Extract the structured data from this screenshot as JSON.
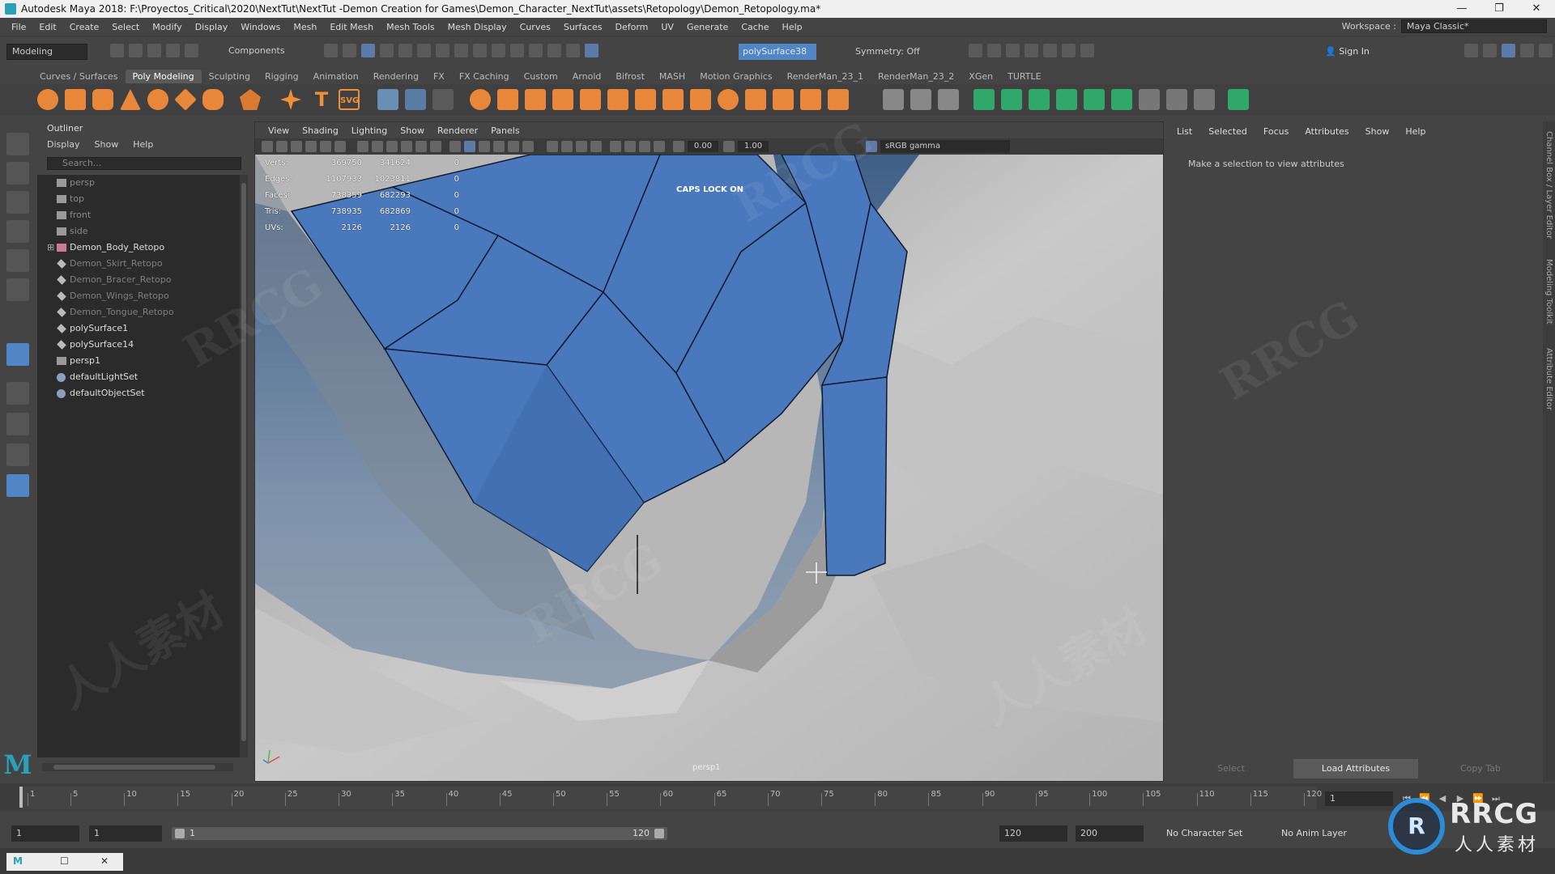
{
  "window": {
    "title": "Autodesk Maya 2018: F:\\Proyectos_Critical\\2020\\NextTut\\NextTut -Demon Creation for Games\\Demon_Character_NextTut\\assets\\Retopology\\Demon_Retopology.ma*",
    "controls": [
      "—",
      "❐",
      "✕"
    ]
  },
  "menubar": {
    "items": [
      "File",
      "Edit",
      "Create",
      "Select",
      "Modify",
      "Display",
      "Windows",
      "Mesh",
      "Edit Mesh",
      "Mesh Tools",
      "Mesh Display",
      "Curves",
      "Surfaces",
      "Deform",
      "UV",
      "Generate",
      "Cache",
      "Help"
    ],
    "workspace_label": "Workspace :",
    "workspace_value": "Maya Classic*"
  },
  "statusline": {
    "mode": "Modeling",
    "selection_mask": "Components",
    "object_field": "polySurface38",
    "symmetry": "Symmetry: Off",
    "sign_in": "Sign In"
  },
  "shelf": {
    "tabs": [
      "Curves / Surfaces",
      "Poly Modeling",
      "Sculpting",
      "Rigging",
      "Animation",
      "Rendering",
      "FX",
      "FX Caching",
      "Custom",
      "Arnold",
      "Bifrost",
      "MASH",
      "Motion Graphics",
      "RenderMan_23_1",
      "RenderMan_23_2",
      "XGen",
      "TURTLE"
    ],
    "active_tab": "Poly Modeling",
    "text_icons": [
      "T",
      "SVG"
    ]
  },
  "outliner": {
    "title": "Outliner",
    "menu": [
      "Display",
      "Show",
      "Help"
    ],
    "search_placeholder": "Search...",
    "items": [
      {
        "label": "persp",
        "icon": "camera-icon",
        "state": "dim"
      },
      {
        "label": "top",
        "icon": "camera-icon",
        "state": "dim"
      },
      {
        "label": "front",
        "icon": "camera-icon",
        "state": "dim"
      },
      {
        "label": "side",
        "icon": "camera-icon",
        "state": "dim"
      },
      {
        "label": "Demon_Body_Retopo",
        "icon": "group-icon",
        "state": "normal",
        "expander": "⊞"
      },
      {
        "label": "Demon_Skirt_Retopo",
        "icon": "mesh-icon",
        "state": "hidden"
      },
      {
        "label": "Demon_Bracer_Retopo",
        "icon": "mesh-icon",
        "state": "hidden"
      },
      {
        "label": "Demon_Wings_Retopo",
        "icon": "mesh-icon",
        "state": "hidden"
      },
      {
        "label": "Demon_Tongue_Retopo",
        "icon": "mesh-icon",
        "state": "hidden"
      },
      {
        "label": "polySurface1",
        "icon": "mesh-icon",
        "state": "normal"
      },
      {
        "label": "polySurface14",
        "icon": "mesh-icon",
        "state": "normal"
      },
      {
        "label": "persp1",
        "icon": "camera-icon",
        "state": "normal"
      },
      {
        "label": "defaultLightSet",
        "icon": "set-icon",
        "state": "normal"
      },
      {
        "label": "defaultObjectSet",
        "icon": "set-icon",
        "state": "normal"
      }
    ]
  },
  "viewport": {
    "menu": [
      "View",
      "Shading",
      "Lighting",
      "Show",
      "Renderer",
      "Panels"
    ],
    "exposure": "0.00",
    "gamma": "1.00",
    "color_space": "sRGB gamma",
    "hud": [
      {
        "label": "Verts:",
        "v1": "369750",
        "v2": "341624",
        "v3": "0"
      },
      {
        "label": "Edges:",
        "v1": "1107933",
        "v2": "1023811",
        "v3": "0"
      },
      {
        "label": "Faces:",
        "v1": "738359",
        "v2": "682293",
        "v3": "0"
      },
      {
        "label": "Tris:",
        "v1": "738935",
        "v2": "682869",
        "v3": "0"
      },
      {
        "label": "UVs:",
        "v1": "2126",
        "v2": "2126",
        "v3": "0"
      }
    ],
    "caps_lock": "CAPS LOCK ON",
    "camera": "persp1",
    "retopo_color": "#4a78bd"
  },
  "attribute_editor": {
    "menu": [
      "List",
      "Selected",
      "Focus",
      "Attributes",
      "Show",
      "Help"
    ],
    "message": "Make a selection to view attributes",
    "buttons": [
      "Select",
      "Load Attributes",
      "Copy Tab"
    ]
  },
  "side_tabs": [
    "Channel Box / Layer Editor",
    "Modeling Toolkit",
    "Attribute Editor"
  ],
  "timeslider": {
    "labels": [
      "1",
      "5",
      "10",
      "15",
      "20",
      "25",
      "30",
      "35",
      "40",
      "45",
      "50",
      "55",
      "60",
      "65",
      "70",
      "75",
      "80",
      "85",
      "90",
      "95",
      "100",
      "105",
      "110",
      "115",
      "120"
    ],
    "current_frame": "1",
    "playback": [
      "⏮",
      "⏪",
      "◀",
      "▶",
      "⏩",
      "⏭"
    ]
  },
  "rangeslider": {
    "start": "1",
    "playback_start": "1",
    "range_left": "1",
    "range_right": "120",
    "playback_end": "120",
    "end": "200",
    "character_set": "No Character Set",
    "anim_layer": "No Anim Layer"
  },
  "cmdline": {
    "label": "M"
  },
  "watermark": {
    "text": "RRCG",
    "text_cn": "人人素材"
  },
  "colors": {
    "accent": "#5285c4",
    "panel": "#444444",
    "field": "#2b2b2b"
  }
}
